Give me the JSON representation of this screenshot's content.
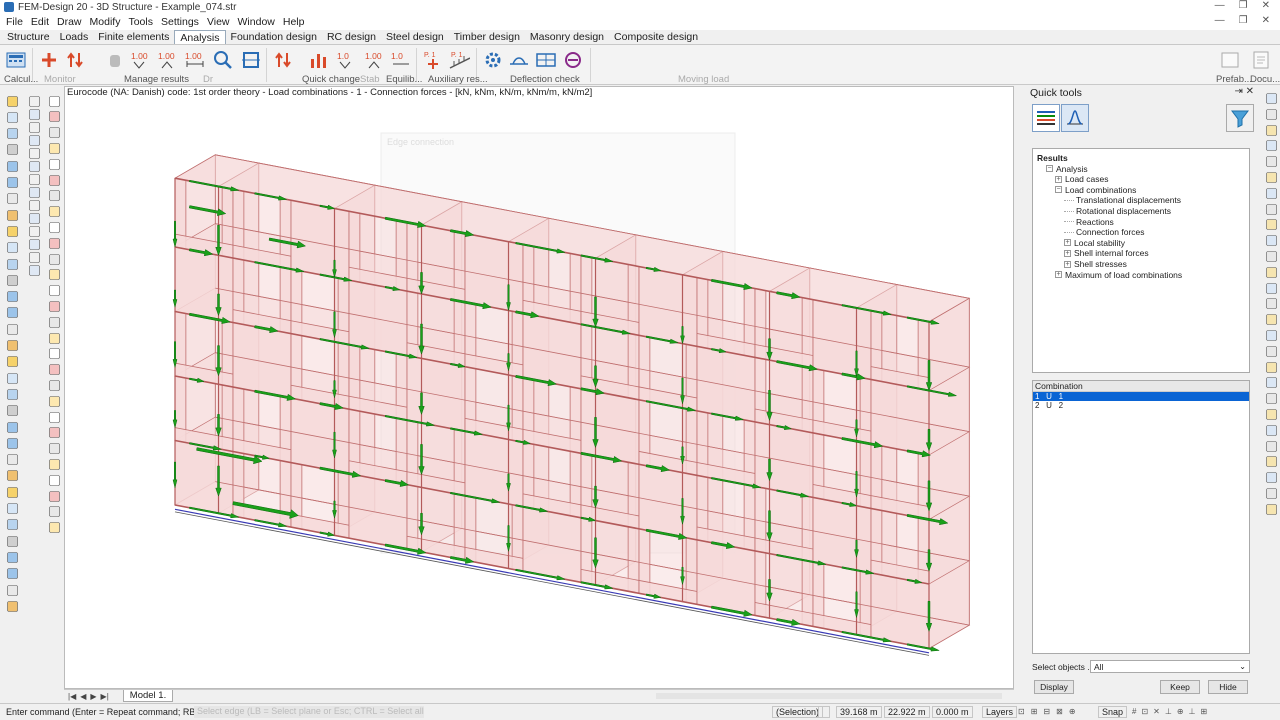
{
  "window": {
    "title": "FEM-Design 20 - 3D Structure - Example_074.str"
  },
  "menu": [
    "File",
    "Edit",
    "Draw",
    "Modify",
    "Tools",
    "Settings",
    "View",
    "Window",
    "Help"
  ],
  "tabs": [
    "Structure",
    "Loads",
    "Finite elements",
    "Analysis",
    "Foundation design",
    "RC design",
    "Steel design",
    "Timber design",
    "Masonry design",
    "Composite design"
  ],
  "active_tab": "Analysis",
  "ribbon": {
    "groups": [
      "Calcul...",
      "Manage results",
      "Quick change",
      "Equilib...",
      "Auxiliary res...",
      "Deflection check",
      "Prefab...",
      "Docu..."
    ],
    "dim_groups": [
      "Monitor",
      "Dr",
      "Stab",
      "Moving load"
    ],
    "num_buttons": [
      "1.00",
      "1.00",
      "1.00",
      "1.0",
      "1.00",
      "1.0"
    ],
    "point_labels": [
      "P. 1",
      "P. 1"
    ]
  },
  "canvas": {
    "info": "Eurocode (NA: Danish) code: 1st order theory - Load combinations - 1 - Connection forces - [kN, kNm, kN/m, kNm/m, kN/m2]",
    "ghost_dialog_title": "Edge connection"
  },
  "model_tab": "Model 1.",
  "quick_tools": {
    "title": "Quick tools",
    "tree": [
      {
        "label": "Results",
        "level": 0,
        "exp": "",
        "bold": true
      },
      {
        "label": "Analysis",
        "level": 1,
        "exp": "−"
      },
      {
        "label": "Load cases",
        "level": 2,
        "exp": "+"
      },
      {
        "label": "Load combinations",
        "level": 2,
        "exp": "−"
      },
      {
        "label": "Translational displacements",
        "level": 3,
        "exp": ""
      },
      {
        "label": "Rotational displacements",
        "level": 3,
        "exp": ""
      },
      {
        "label": "Reactions",
        "level": 3,
        "exp": ""
      },
      {
        "label": "Connection forces",
        "level": 3,
        "exp": ""
      },
      {
        "label": "Local stability",
        "level": 3,
        "exp": "+"
      },
      {
        "label": "Shell internal forces",
        "level": 3,
        "exp": "+"
      },
      {
        "label": "Shell stresses",
        "level": 3,
        "exp": "+"
      },
      {
        "label": "Maximum of load combinations",
        "level": 2,
        "exp": "+"
      }
    ],
    "combination_header": "Combination",
    "combinations": [
      "1   U   1",
      "2   U   2"
    ],
    "selected_combination": 0,
    "select_objects_label": "Select objects ....",
    "select_objects_value": "All",
    "buttons": {
      "display": "Display",
      "keep": "Keep",
      "hide": "Hide"
    }
  },
  "status": {
    "command_prompt": "Enter command (Enter = Repeat command; RB = Modify):",
    "command_hint": "Select edge (LB = Select plane or Esc; CTRL = Select all; ...",
    "selection": "(Selection)",
    "x": "39.168 m",
    "y": "22.922 m",
    "z": "0.000 m",
    "layers": "Layers",
    "snap": "Snap"
  },
  "colors": {
    "wall_fill": "#f6d9d9",
    "wall_stroke": "#c07070",
    "force_arrow": "#1aa01a",
    "accent": "#0a64d4"
  }
}
